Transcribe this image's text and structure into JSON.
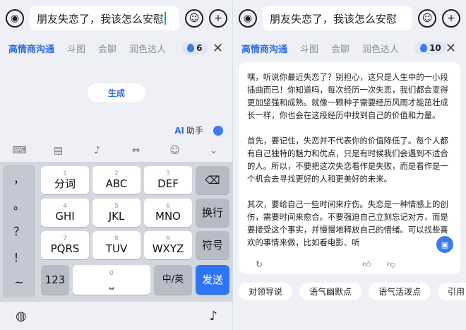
{
  "left": {
    "input_text": "朋友失恋了，我该怎么安慰",
    "tabs": [
      "高情商沟通",
      "斗图",
      "会聊",
      "润色达人"
    ],
    "badge_count": "6",
    "generate_label": "生成",
    "ai_label": "AI",
    "helper_label": "助手",
    "punctuation": [
      "，",
      "。",
      "？",
      "！",
      "~"
    ],
    "keys": {
      "r1": [
        {
          "num": "1",
          "lbl": "分词"
        },
        {
          "num": "2",
          "lbl": "ABC"
        },
        {
          "num": "3",
          "lbl": "DEF"
        }
      ],
      "r2": [
        {
          "num": "4",
          "lbl": "GHI"
        },
        {
          "num": "5",
          "lbl": "JKL"
        },
        {
          "num": "6",
          "lbl": "MNO"
        }
      ],
      "r3": [
        {
          "num": "7",
          "lbl": "PQRS"
        },
        {
          "num": "8",
          "lbl": "TUV"
        },
        {
          "num": "9",
          "lbl": "WXYZ"
        }
      ],
      "r4": [
        {
          "num": "",
          "lbl": "123"
        },
        {
          "num": "0",
          "lbl": ""
        },
        {
          "num": "",
          "lbl": "中/英"
        }
      ]
    },
    "side_keys": {
      "delete": "⌫",
      "newline": "换行",
      "symbol": "符号",
      "send": "发送"
    }
  },
  "right": {
    "input_text": "朋友失恋了，我该怎么安慰",
    "tabs": [
      "高情商沟通",
      "斗图",
      "会聊",
      "润色达人"
    ],
    "badge_count": "10",
    "paragraphs": [
      "嘿，听说你最近失恋了？别担心，这只是人生中的一小段插曲而已！你知道吗，每次经历一次失恋，我们都会变得更加坚强和成熟。就像一颗种子需要经历风雨才能茁壮成长一样，你也会在这段经历中找到自己的价值和力量。",
      "首先，要记住，失恋并不代表你的价值降低了。每个人都有自己独特的魅力和优点，只是有时候我们会遇到不适合的人。所以，不要把这次失恋看作是失败，而是看作是一个机会去寻找更好的人和更美好的未来。",
      "其次，要给自己一些时间来疗伤。失恋是一种情感上的创伤，需要时间来愈合。不要强迫自己立刻忘记对方，而是要接受这个事实，并慢慢地释放自己的情绪。可以找些喜欢的事情来做，比如看电影、听"
    ],
    "suggestions": [
      "对领导说",
      "语气幽默点",
      "语气活泼点",
      "引用"
    ]
  }
}
